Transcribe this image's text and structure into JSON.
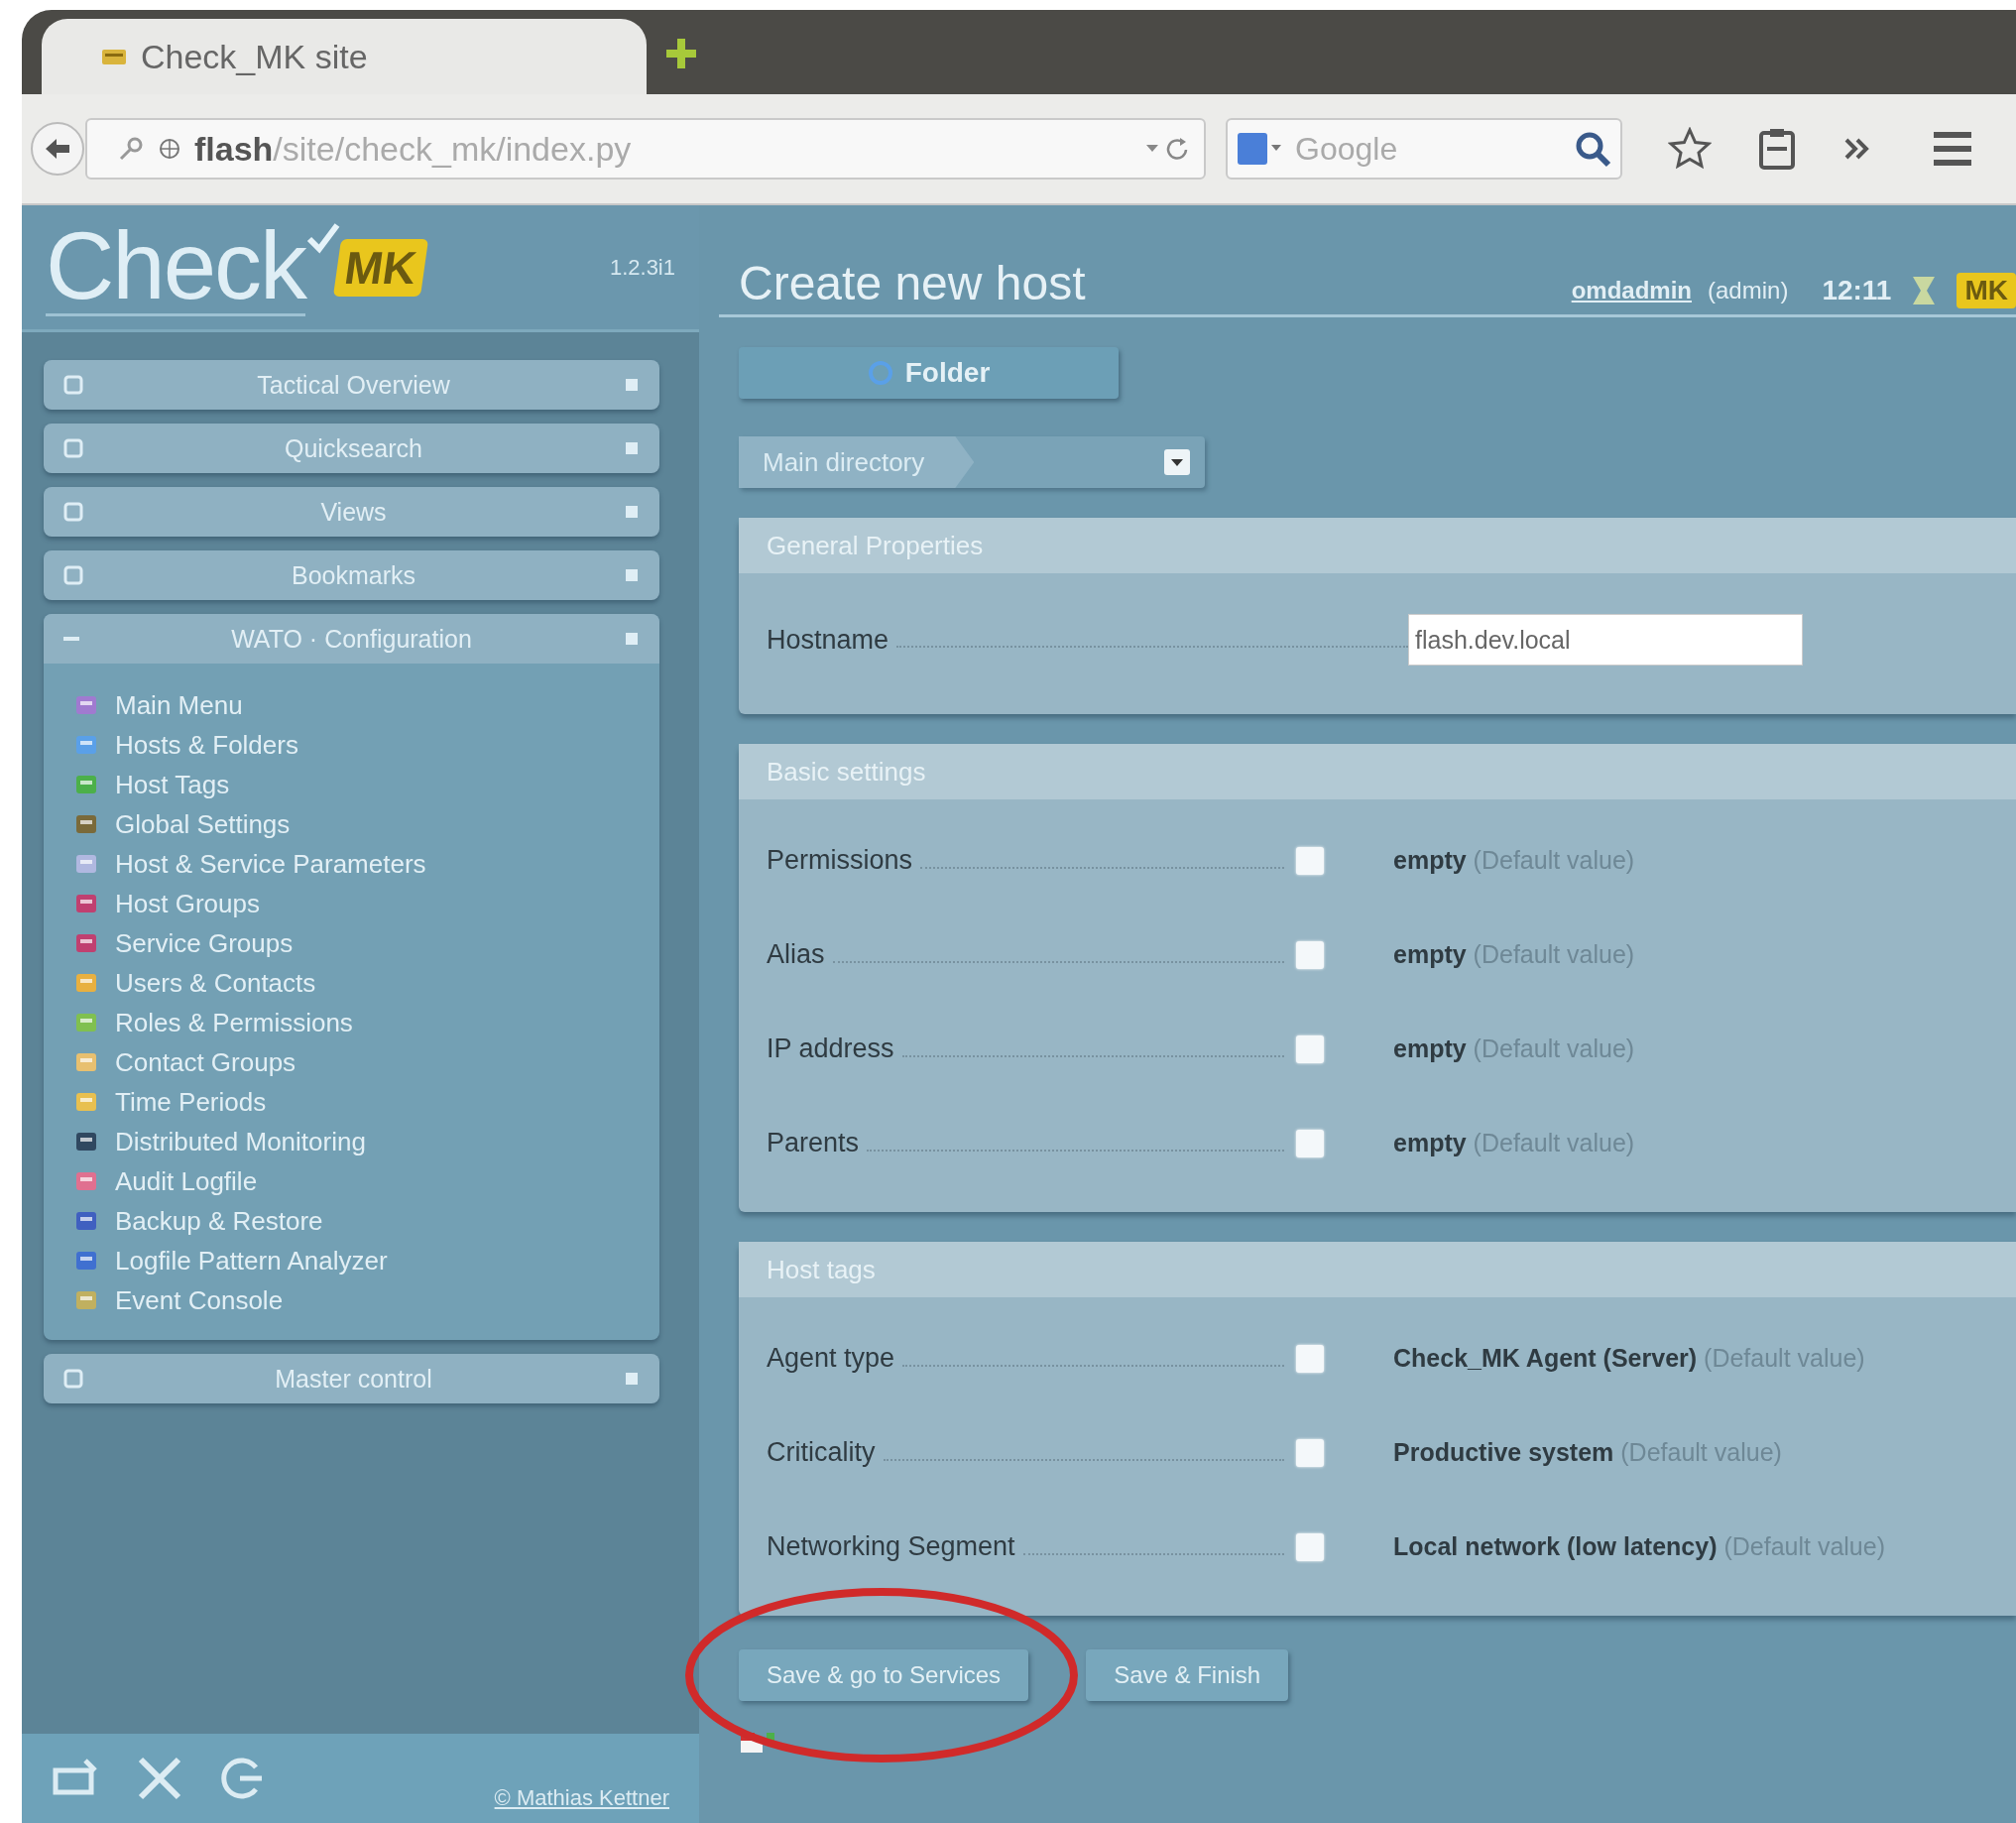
{
  "browser": {
    "tab": {
      "title": "Check_MK site"
    },
    "url": {
      "host": "flash",
      "path": "/site/check_mk/index.py"
    },
    "search": {
      "placeholder": "Google"
    }
  },
  "sidebar": {
    "logo": {
      "text": "Check",
      "badge": "MK",
      "version": "1.2.3i1"
    },
    "snapins": [
      {
        "title": "Tactical Overview",
        "expanded": false
      },
      {
        "title": "Quicksearch",
        "expanded": false
      },
      {
        "title": "Views",
        "expanded": false
      },
      {
        "title": "Bookmarks",
        "expanded": false
      },
      {
        "title": "WATO · Configuration",
        "expanded": true,
        "items": [
          "Main Menu",
          "Hosts & Folders",
          "Host Tags",
          "Global Settings",
          "Host & Service Parameters",
          "Host Groups",
          "Service Groups",
          "Users & Contacts",
          "Roles & Permissions",
          "Contact Groups",
          "Time Periods",
          "Distributed Monitoring",
          "Audit Logfile",
          "Backup & Restore",
          "Logfile Pattern Analyzer",
          "Event Console"
        ]
      },
      {
        "title": "Master control",
        "expanded": false
      }
    ],
    "footer": {
      "copyright": "© Mathias Kettner"
    }
  },
  "main": {
    "title": "Create new host",
    "user": "omdadmin",
    "role": "(admin)",
    "time": "12:11",
    "badge": "MK",
    "folder_button": "Folder",
    "breadcrumb": "Main directory",
    "sections": [
      {
        "title": "General Properties",
        "rows": [
          {
            "kind": "field",
            "label": "Hostname",
            "value": "flash.dev.local"
          }
        ]
      },
      {
        "title": "Basic settings",
        "rows": [
          {
            "kind": "option",
            "label": "Permissions",
            "checked": false,
            "value": "empty",
            "note": "(Default value)"
          },
          {
            "kind": "option",
            "label": "Alias",
            "checked": false,
            "value": "empty",
            "note": "(Default value)"
          },
          {
            "kind": "option",
            "label": "IP address",
            "checked": false,
            "value": "empty",
            "note": "(Default value)"
          },
          {
            "kind": "option",
            "label": "Parents",
            "checked": false,
            "value": "empty",
            "note": "(Default value)"
          }
        ]
      },
      {
        "title": "Host tags",
        "rows": [
          {
            "kind": "option",
            "label": "Agent type",
            "checked": false,
            "value": "Check_MK Agent (Server)",
            "note": "(Default value)"
          },
          {
            "kind": "option",
            "label": "Criticality",
            "checked": false,
            "value": "Productive system",
            "note": "(Default value)"
          },
          {
            "kind": "option",
            "label": "Networking Segment",
            "checked": false,
            "value": "Local network (low latency)",
            "note": "(Default value)"
          }
        ]
      }
    ],
    "buttons": [
      {
        "label": "Save & go to Services",
        "highlighted": true
      },
      {
        "label": "Save & Finish",
        "highlighted": false
      }
    ]
  }
}
